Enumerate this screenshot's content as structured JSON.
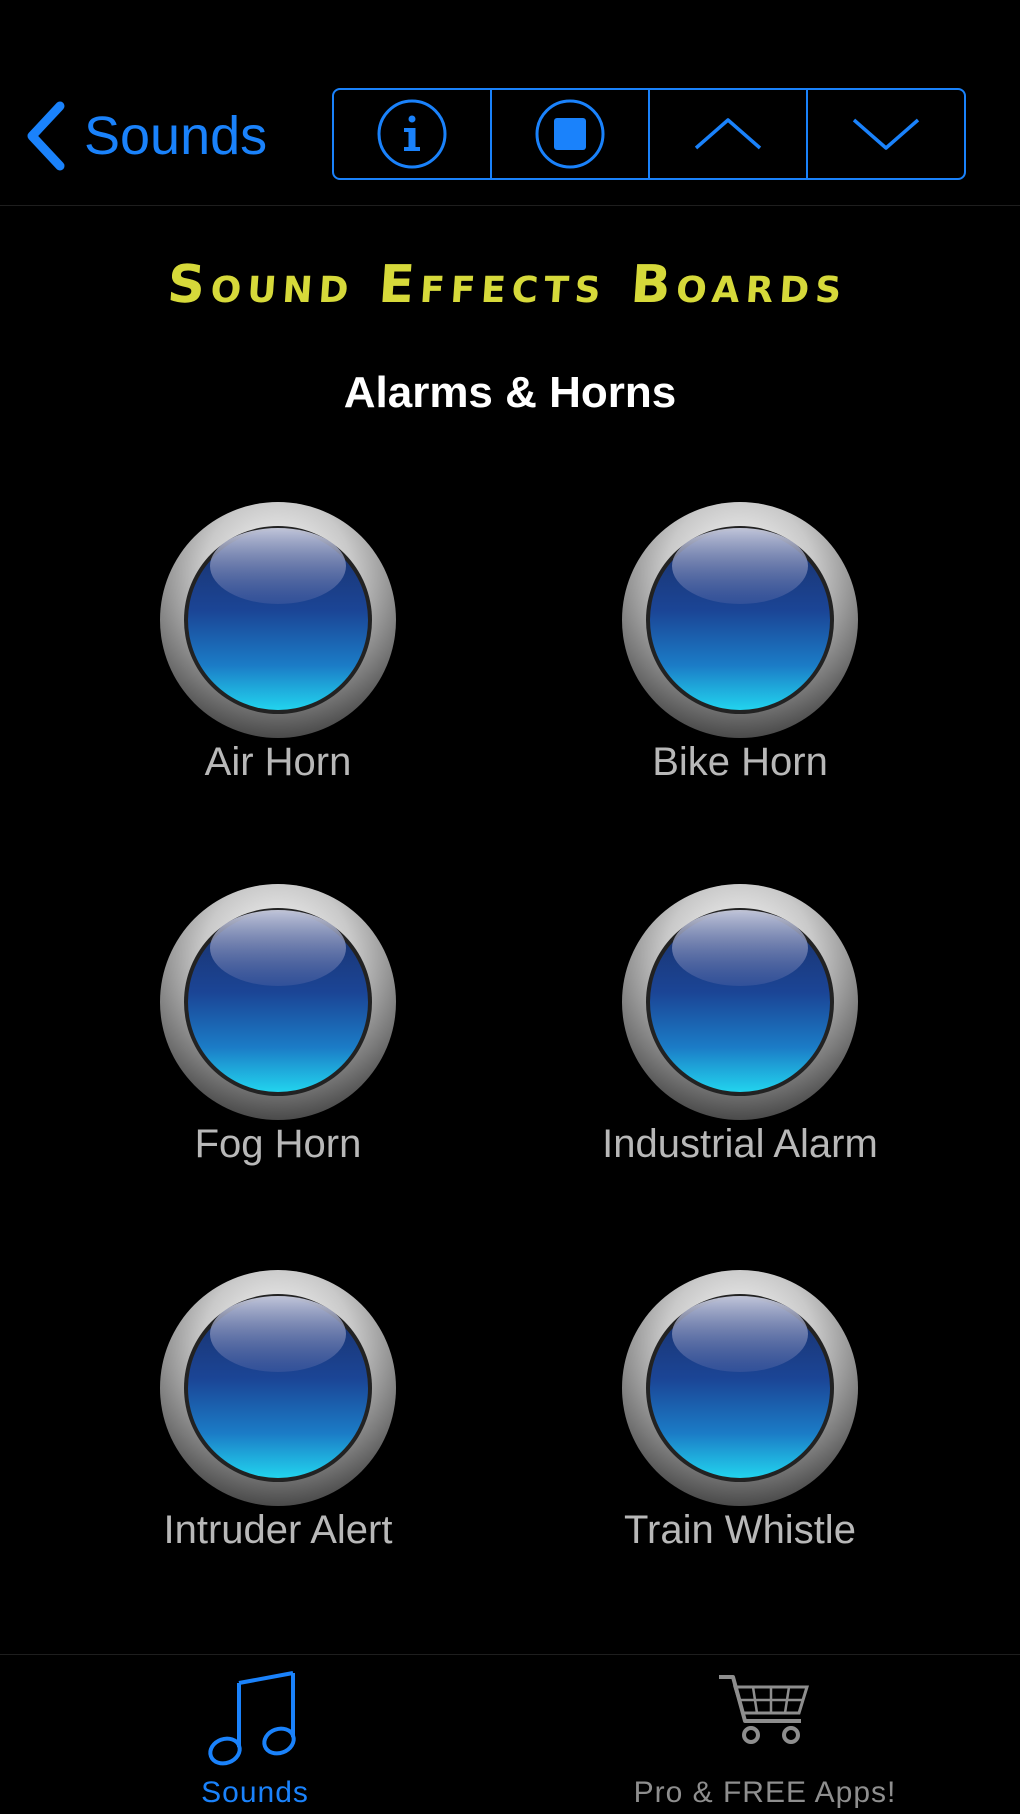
{
  "navbar": {
    "back_label": "Sounds",
    "toolbar_buttons": [
      {
        "icon": "info-icon"
      },
      {
        "icon": "stop-icon"
      },
      {
        "icon": "chevron-up-icon"
      },
      {
        "icon": "chevron-down-icon"
      }
    ]
  },
  "board": {
    "title": "Sound Effects Boards",
    "section_title": "Alarms & Horns"
  },
  "sounds": [
    {
      "label": "Air Horn"
    },
    {
      "label": "Bike Horn"
    },
    {
      "label": "Fog Horn"
    },
    {
      "label": "Industrial Alarm"
    },
    {
      "label": "Intruder Alert"
    },
    {
      "label": "Train Whistle"
    }
  ],
  "tabbar": {
    "tabs": [
      {
        "label": "Sounds",
        "icon": "music-note-icon",
        "active": true
      },
      {
        "label": "Pro & FREE Apps!",
        "icon": "shopping-cart-icon",
        "active": false
      }
    ]
  },
  "colors": {
    "accent": "#1a82fb",
    "title_yellow": "#d6d93a",
    "background": "#000000"
  }
}
